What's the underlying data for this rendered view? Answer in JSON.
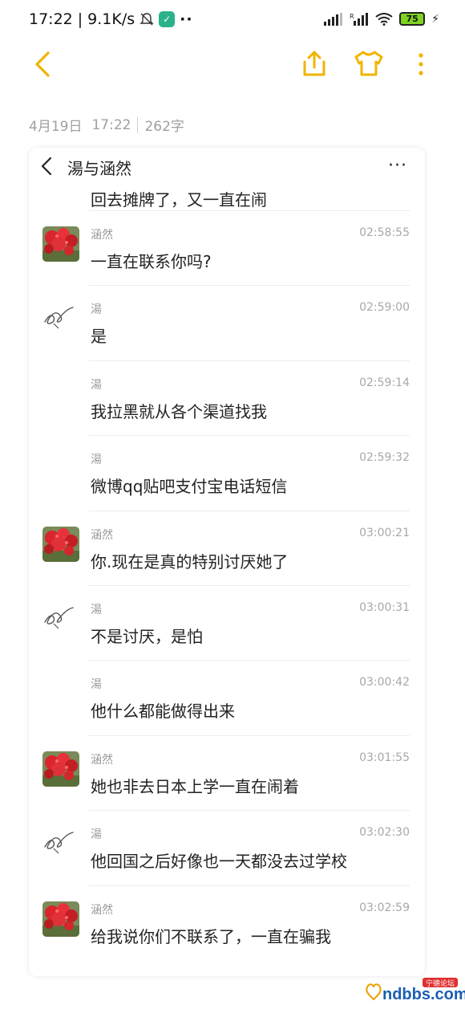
{
  "status": {
    "time": "17:22",
    "speed": "9.1K/s",
    "dots": "··",
    "battery": "75"
  },
  "note": {
    "date": "4月19日",
    "time": "17:22",
    "count": "262字"
  },
  "chat": {
    "title": "湯与涵然",
    "more": "···",
    "first_message": "回去摊牌了，又一直在闹",
    "messages": [
      {
        "sender": "涵然",
        "time": "02:58:55",
        "text": "一直在联系你吗?",
        "avatar": "flower"
      },
      {
        "sender": "湯",
        "time": "02:59:00",
        "text": "是",
        "avatar": "signature"
      },
      {
        "sender": "湯",
        "time": "02:59:14",
        "text": "我拉黑就从各个渠道找我",
        "avatar": "none"
      },
      {
        "sender": "湯",
        "time": "02:59:32",
        "text": "微博qq贴吧支付宝电话短信",
        "avatar": "none"
      },
      {
        "sender": "涵然",
        "time": "03:00:21",
        "text": "你.现在是真的特别讨厌她了",
        "avatar": "flower"
      },
      {
        "sender": "湯",
        "time": "03:00:31",
        "text": "不是讨厌，是怕",
        "avatar": "signature"
      },
      {
        "sender": "湯",
        "time": "03:00:42",
        "text": "他什么都能做得出来",
        "avatar": "none"
      },
      {
        "sender": "涵然",
        "time": "03:01:55",
        "text": "她也非去日本上学一直在闹着",
        "avatar": "flower"
      },
      {
        "sender": "湯",
        "time": "03:02:30",
        "text": "他回国之后好像也一天都没去过学校",
        "avatar": "signature"
      },
      {
        "sender": "涵然",
        "time": "03:02:59",
        "text": "给我说你们不联系了，一直在骗我",
        "avatar": "flower"
      }
    ]
  },
  "watermark": {
    "text": "ndbbs.com",
    "badge": "宁德论坛"
  },
  "colors": {
    "accent": "#f0b400",
    "muted": "#a0a0a0",
    "divider": "#ececec"
  }
}
